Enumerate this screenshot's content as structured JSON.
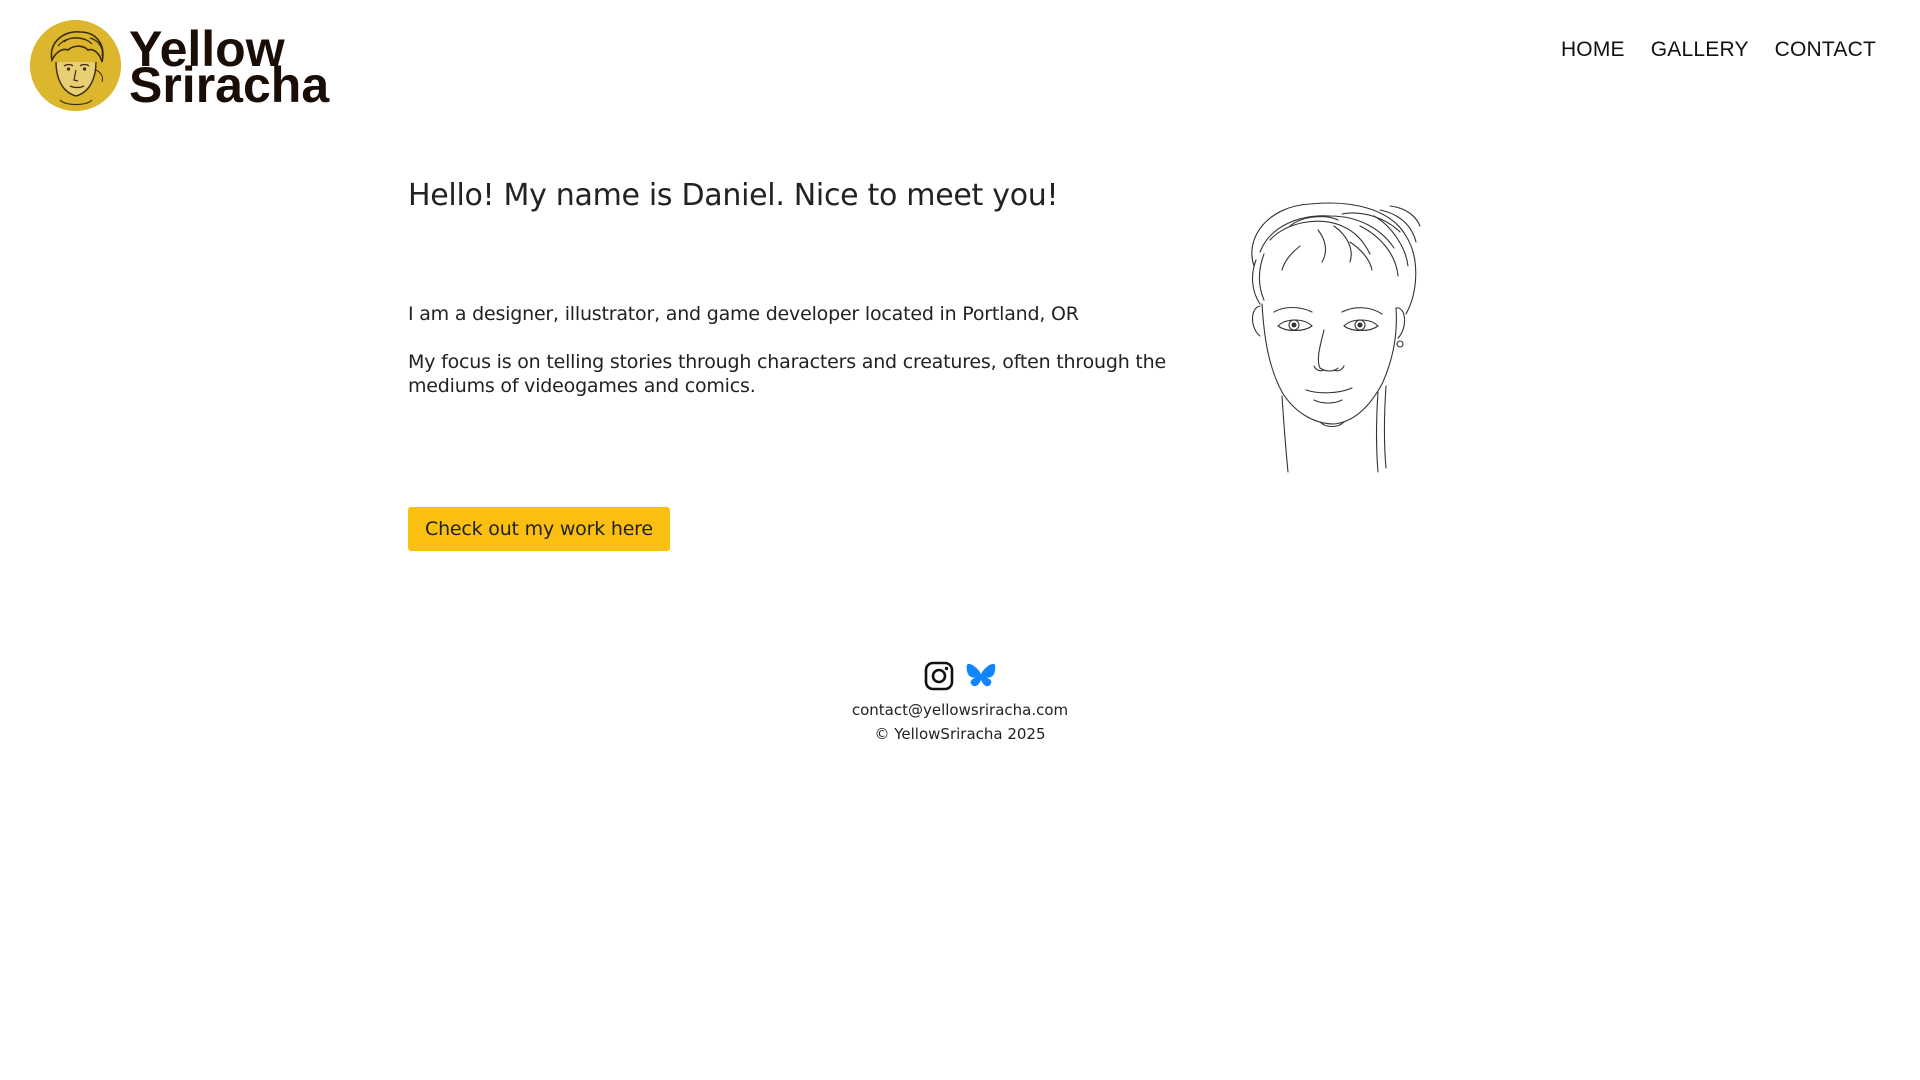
{
  "header": {
    "logo": {
      "line1": "Yellow",
      "line2": "Sriracha",
      "avatar_icon": "portrait-avatar-icon",
      "avatar_color": "#dcb62c"
    },
    "nav": [
      {
        "label": "HOME"
      },
      {
        "label": "GALLERY"
      },
      {
        "label": "CONTACT"
      }
    ]
  },
  "main": {
    "headline": "Hello! My name is Daniel. Nice to meet you!",
    "intro": "I am a designer, illustrator, and game developer located in Portland, OR",
    "focus": "My focus is on telling stories through characters and creatures, often through the mediums of videogames and comics.",
    "cta_label": "Check out my work here",
    "cta_color": "#fbbf12",
    "portrait_icon": "sketch-portrait"
  },
  "footer": {
    "social": [
      {
        "icon": "instagram-icon",
        "color": "#111111"
      },
      {
        "icon": "bluesky-icon",
        "color": "#1185fe"
      }
    ],
    "email": "contact@yellowsriracha.com",
    "copyright": "© YellowSriracha 2025"
  }
}
